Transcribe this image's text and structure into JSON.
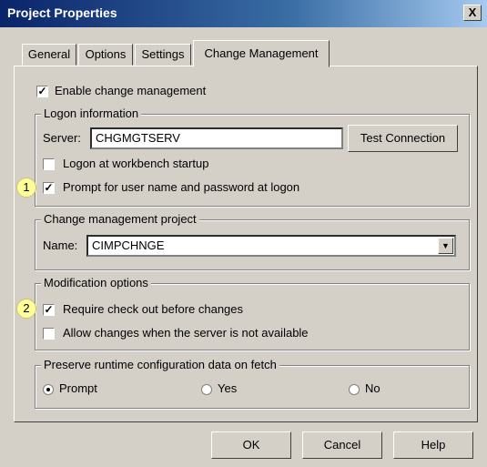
{
  "window": {
    "title": "Project Properties",
    "close_glyph": "X"
  },
  "tabs": [
    "General",
    "Options",
    "Settings",
    "Change Management"
  ],
  "enable_cm": {
    "label": "Enable change management",
    "checked": true
  },
  "logon": {
    "title": "Logon information",
    "server_label": "Server:",
    "server_value": "CHGMGTSERV",
    "test_button": "Test Connection",
    "logon_startup": {
      "label": "Logon at workbench startup",
      "checked": false
    },
    "prompt_user": {
      "label": "Prompt for user name and password at logon",
      "checked": true
    }
  },
  "project": {
    "title": "Change management project",
    "name_label": "Name:",
    "name_value": "CIMPCHNGE"
  },
  "modification": {
    "title": "Modification options",
    "require_checkout": {
      "label": "Require check out before changes",
      "checked": true
    },
    "allow_changes": {
      "label": "Allow changes when the server is not available",
      "checked": false
    }
  },
  "preserve": {
    "title": "Preserve runtime configuration data on fetch",
    "options": [
      "Prompt",
      "Yes",
      "No"
    ],
    "selected": "Prompt"
  },
  "buttons": {
    "ok": "OK",
    "cancel": "Cancel",
    "help": "Help"
  },
  "callouts": [
    "1",
    "2"
  ],
  "colors": {
    "titlebar": "#0a246a",
    "dialog": "#d4d0c8",
    "callout": "#ffff99"
  }
}
